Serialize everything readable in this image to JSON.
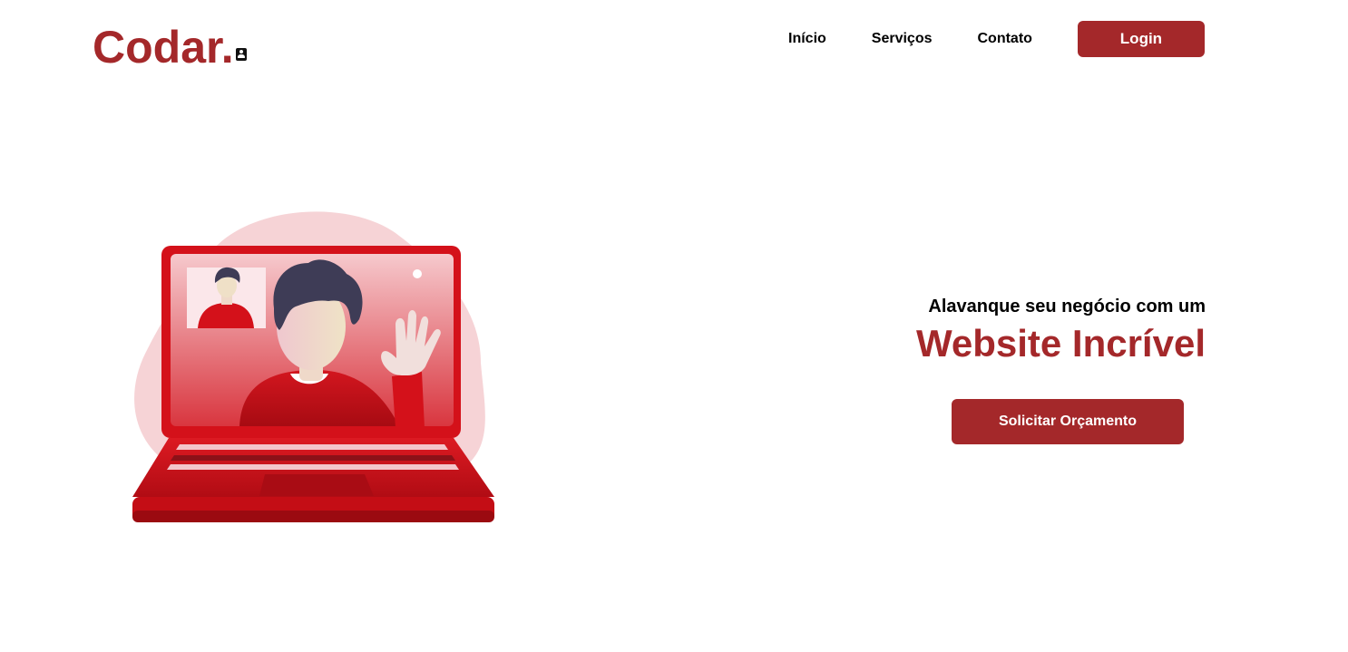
{
  "brand": {
    "logo_text": "Codar.",
    "accent_color": "#a4282a"
  },
  "nav": {
    "items": [
      {
        "label": "Início"
      },
      {
        "label": "Serviços"
      },
      {
        "label": "Contato"
      }
    ],
    "login_label": "Login"
  },
  "hero": {
    "subtitle": "Alavanque seu negócio com um",
    "title": "Website Incrível",
    "cta_label": "Solicitar Orçamento"
  },
  "illustration": {
    "icon": "laptop-video-call-illustration",
    "colors": {
      "blob": "#f6d3d6",
      "laptop": "#d4111a",
      "screen_top": "#f4bfc4",
      "screen_bottom": "#d9363f",
      "hair": "#3e3c56"
    }
  }
}
